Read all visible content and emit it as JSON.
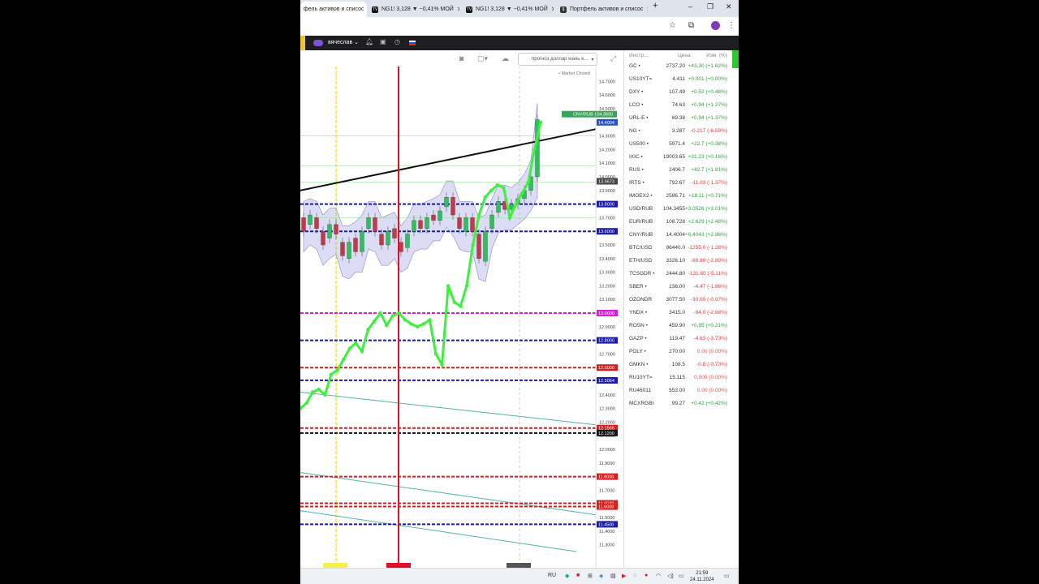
{
  "browser": {
    "tabs": [
      {
        "title": "фель активов и списос",
        "icon": "invest-favicon-icon",
        "active": true
      },
      {
        "title": "NG1! 3,128 ▼ −0,41% МОЙ",
        "icon": "tradingview-favicon-icon",
        "active": false
      },
      {
        "title": "NG1! 3,128 ▼ −0,41% МОЙ",
        "icon": "tradingview-favicon-icon",
        "active": false
      },
      {
        "title": "Портфель активов и списос",
        "icon": "invest-favicon-icon",
        "active": false
      }
    ],
    "new_tab": "+",
    "window": {
      "minimize": "–",
      "restore": "❐",
      "close": "✕"
    }
  },
  "app": {
    "username": "вячеслав",
    "user_chevron": "⌄",
    "icons": [
      "bell-icon",
      "briefcase-icon",
      "clock-icon",
      "flag-icon"
    ]
  },
  "chart_toolbar": {
    "forecast_label": "прогноз доллар юань е...",
    "market_status": "• Market Closed"
  },
  "chart_data": {
    "type": "line",
    "title": "",
    "y_axis_ticks": [
      "14.7000",
      "14.6000",
      "14.5000",
      "14.4000",
      "14.3000",
      "14.2000",
      "14.1000",
      "14.0000",
      "13.9000",
      "13.8000",
      "13.7000",
      "13.6000",
      "13.5000",
      "13.4000",
      "13.3000",
      "13.2000",
      "13.1000",
      "13.0000",
      "12.9000",
      "12.8000",
      "12.7000",
      "12.6000",
      "12.5000",
      "12.4000",
      "12.3000",
      "12.2000",
      "12.1000",
      "12.0000",
      "11.9000",
      "11.8000",
      "11.7000",
      "11.6000",
      "11.5000",
      "11.4000",
      "11.3000"
    ],
    "ylim": [
      11.25,
      14.75
    ],
    "current_price_label": "14.4004",
    "symbol_tag": "CNY/RUB",
    "symbol_tag_value": "104.3500",
    "hover_price_label": "13.9673",
    "horizontal_levels": [
      {
        "value": 13.8,
        "label": "13.8000",
        "color": "#1a1aa8"
      },
      {
        "value": 13.6,
        "label": "13.6000",
        "color": "#1a1aa8"
      },
      {
        "value": 13.0,
        "label": "13.0000",
        "color": "#d61fd6"
      },
      {
        "value": 12.8,
        "label": "12.8000",
        "color": "#1a1aa8"
      },
      {
        "value": 12.6,
        "label": "12.6000",
        "color": "#d41f1f"
      },
      {
        "value": 12.5064,
        "label": "12.5064",
        "color": "#1a1aa8"
      },
      {
        "value": 12.1565,
        "label": "12.1565",
        "color": "#d41f1f"
      },
      {
        "value": 12.12,
        "label": "12.1200",
        "color": "#111111"
      },
      {
        "value": 11.8,
        "label": "11.8000",
        "color": "#d41f1f"
      },
      {
        "value": 11.604,
        "label": "11.6040",
        "color": "#d41f1f"
      },
      {
        "value": 11.58,
        "label": "11.6000",
        "color": "#d41f1f"
      },
      {
        "value": 11.45,
        "label": "11.4500",
        "color": "#1a1aa8"
      }
    ],
    "green_series": [
      12.3,
      12.34,
      12.42,
      12.44,
      12.4,
      12.55,
      12.58,
      12.66,
      12.74,
      12.78,
      12.72,
      12.88,
      12.94,
      13.0,
      12.91,
      12.98,
      13.0,
      12.95,
      12.92,
      12.9,
      12.92,
      12.95,
      12.7,
      12.62,
      13.2,
      13.08,
      13.05,
      13.2,
      13.5,
      13.72,
      13.85,
      13.9,
      13.94,
      13.92,
      13.7,
      13.8,
      13.88,
      13.96,
      14.2,
      14.4
    ],
    "candles": [
      [
        13.7,
        13.6
      ],
      [
        13.65,
        13.72
      ],
      [
        13.7,
        13.62
      ],
      [
        13.6,
        13.5
      ],
      [
        13.55,
        13.65
      ],
      [
        13.65,
        13.58
      ],
      [
        13.52,
        13.42
      ],
      [
        13.4,
        13.52
      ],
      [
        13.55,
        13.45
      ],
      [
        13.45,
        13.6
      ],
      [
        13.62,
        13.7
      ],
      [
        13.7,
        13.6
      ],
      [
        13.58,
        13.5
      ],
      [
        13.5,
        13.6
      ],
      [
        13.62,
        13.55
      ],
      [
        13.52,
        13.45
      ],
      [
        13.48,
        13.58
      ],
      [
        13.6,
        13.68
      ],
      [
        13.68,
        13.62
      ],
      [
        13.62,
        13.7
      ],
      [
        13.72,
        13.68
      ],
      [
        13.68,
        13.75
      ],
      [
        13.78,
        13.85
      ],
      [
        13.85,
        13.72
      ],
      [
        13.7,
        13.62
      ],
      [
        13.6,
        13.7
      ],
      [
        13.7,
        13.6
      ],
      [
        13.58,
        13.4
      ],
      [
        13.38,
        13.6
      ],
      [
        13.62,
        13.72
      ],
      [
        13.74,
        13.82
      ],
      [
        13.82,
        13.76
      ],
      [
        13.76,
        13.8
      ],
      [
        13.8,
        13.84
      ],
      [
        13.84,
        13.9
      ],
      [
        13.9,
        14.0
      ],
      [
        14.0,
        14.42
      ]
    ]
  },
  "watchlist": {
    "headers": {
      "symbol": "Инстр...",
      "price": "Цена",
      "change": "Изм. (%)"
    },
    "rows": [
      {
        "sym": "GC •",
        "price": "2737.20",
        "chg": "+43.30 (+1.62%)",
        "dir": "pos"
      },
      {
        "sym": "US10YT=",
        "price": "4.411",
        "chg": "+0.001 (+0.00%)",
        "dir": "pos"
      },
      {
        "sym": "DXY •",
        "price": "107.49",
        "chg": "+0.52 (+0.48%)",
        "dir": "pos"
      },
      {
        "sym": "LCO •",
        "price": "74.63",
        "chg": "+0.94 (+1.27%)",
        "dir": "pos"
      },
      {
        "sym": "URL-E •",
        "price": "69.38",
        "chg": "+0.94 (+1.37%)",
        "dir": "pos"
      },
      {
        "sym": "NG •",
        "price": "3.287",
        "chg": "-0.217 (-6.59%)",
        "dir": "neg"
      },
      {
        "sym": "US500 •",
        "price": "5971.4",
        "chg": "+22.7 (+0.38%)",
        "dir": "pos"
      },
      {
        "sym": "IXIC •",
        "price": "19003.65",
        "chg": "+31.23 (+0.16%)",
        "dir": "pos"
      },
      {
        "sym": "RUS •",
        "price": "2406.7",
        "chg": "+42.7 (+1.81%)",
        "dir": "pos"
      },
      {
        "sym": "IRTS •",
        "price": "792.67",
        "chg": "-11.03 (-1.37%)",
        "dir": "neg"
      },
      {
        "sym": "IMOEX2 •",
        "price": "2586.71",
        "chg": "+18.11 (+0.71%)",
        "dir": "pos"
      },
      {
        "sym": "USD/RUB",
        "price": "104.3455",
        "chg": "+3.0526 (+3.01%)",
        "dir": "pos"
      },
      {
        "sym": "EUR/RUB",
        "price": "108.728",
        "chg": "+2.629 (+2.48%)",
        "dir": "pos"
      },
      {
        "sym": "CNY/RUB",
        "price": "14.4004",
        "chg": "+0.4043 (+2.86%)",
        "dir": "pos"
      },
      {
        "sym": "BTC/USD",
        "price": "96440.0",
        "chg": "-1255.0 (-1.28%)",
        "dir": "neg"
      },
      {
        "sym": "ETH/USD",
        "price": "3326.10",
        "chg": "-98.89 (-2.89%)",
        "dir": "neg"
      },
      {
        "sym": "TCSGDR •",
        "price": "2444.80",
        "chg": "-131.60 (-5.11%)",
        "dir": "neg"
      },
      {
        "sym": "SBER •",
        "price": "236.00",
        "chg": "-4.47 (-1.86%)",
        "dir": "neg"
      },
      {
        "sym": "OZONDR",
        "price": "3077.50",
        "chg": "-30.00 (-0.97%)",
        "dir": "neg"
      },
      {
        "sym": "YNDX •",
        "price": "3415.0",
        "chg": "-94.0 (-2.68%)",
        "dir": "neg"
      },
      {
        "sym": "ROSN •",
        "price": "459.90",
        "chg": "+0.95 (+0.21%)",
        "dir": "pos"
      },
      {
        "sym": "GAZP •",
        "price": "119.47",
        "chg": "-4.63 (-3.73%)",
        "dir": "neg"
      },
      {
        "sym": "POLY •",
        "price": "270.00",
        "chg": "0.00 (0.00%)",
        "dir": "zero"
      },
      {
        "sym": "GMKN •",
        "price": "108.5",
        "chg": "-0.8 (-0.73%)",
        "dir": "neg"
      },
      {
        "sym": "RU10YT=",
        "price": "15.115",
        "chg": "0.000 (0.00%)",
        "dir": "zero"
      },
      {
        "sym": "RU46011",
        "price": "553.00",
        "chg": "0.00 (0.00%)",
        "dir": "zero"
      },
      {
        "sym": "MCXRGBI",
        "price": "99.27",
        "chg": "+0.42 (+0.42%)",
        "dir": "pos"
      }
    ]
  },
  "taskbar": {
    "lang": "RU",
    "time": "21:59",
    "date": "24.11.2024"
  },
  "colors": {
    "positive": "#2e9e3e",
    "negative": "#e03a3a",
    "series_green": "#3ef03e",
    "cloud_fill": "#9a9ae0",
    "trendline": "#111111"
  }
}
